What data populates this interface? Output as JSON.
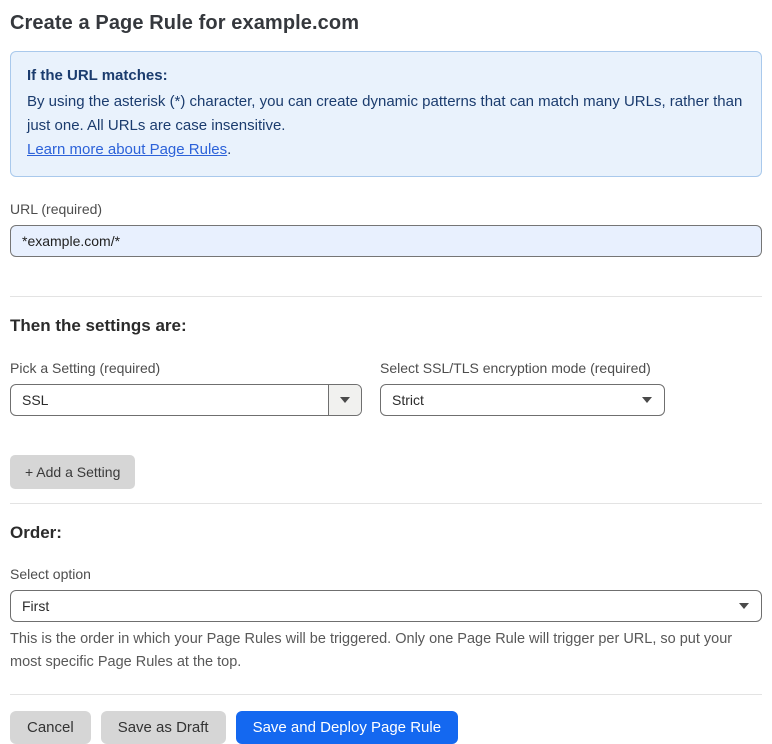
{
  "page": {
    "title": "Create a Page Rule for example.com"
  },
  "info_box": {
    "heading": "If the URL matches:",
    "body": "By using the asterisk (*) character, you can create dynamic patterns that can match many URLs, rather than just one. All URLs are case insensitive.",
    "link": "Learn more about Page Rules",
    "link_suffix": "."
  },
  "url_field": {
    "label": "URL (required)",
    "value": "*example.com/*"
  },
  "settings_section": {
    "heading": "Then the settings are:",
    "setting_picker": {
      "label": "Pick a Setting (required)",
      "value": "SSL"
    },
    "mode_picker": {
      "label": "Select SSL/TLS encryption mode (required)",
      "value": "Strict"
    },
    "add_setting_label": "+ Add a Setting"
  },
  "order_section": {
    "heading": "Order:",
    "select_label": "Select option",
    "value": "First",
    "help_text": "This is the order in which your Page Rules will be triggered. Only one Page Rule will trigger per URL, so put your most specific Page Rules at the top."
  },
  "footer": {
    "cancel_label": "Cancel",
    "save_draft_label": "Save as Draft",
    "save_deploy_label": "Save and Deploy Page Rule"
  },
  "colors": {
    "primary_blue": "#1468f0",
    "info_bg": "#e9f2fc",
    "info_border": "#a9c9ec",
    "info_text": "#1b3c6e",
    "link_blue": "#2c62d9",
    "url_input_bg": "#e8f0fe"
  }
}
